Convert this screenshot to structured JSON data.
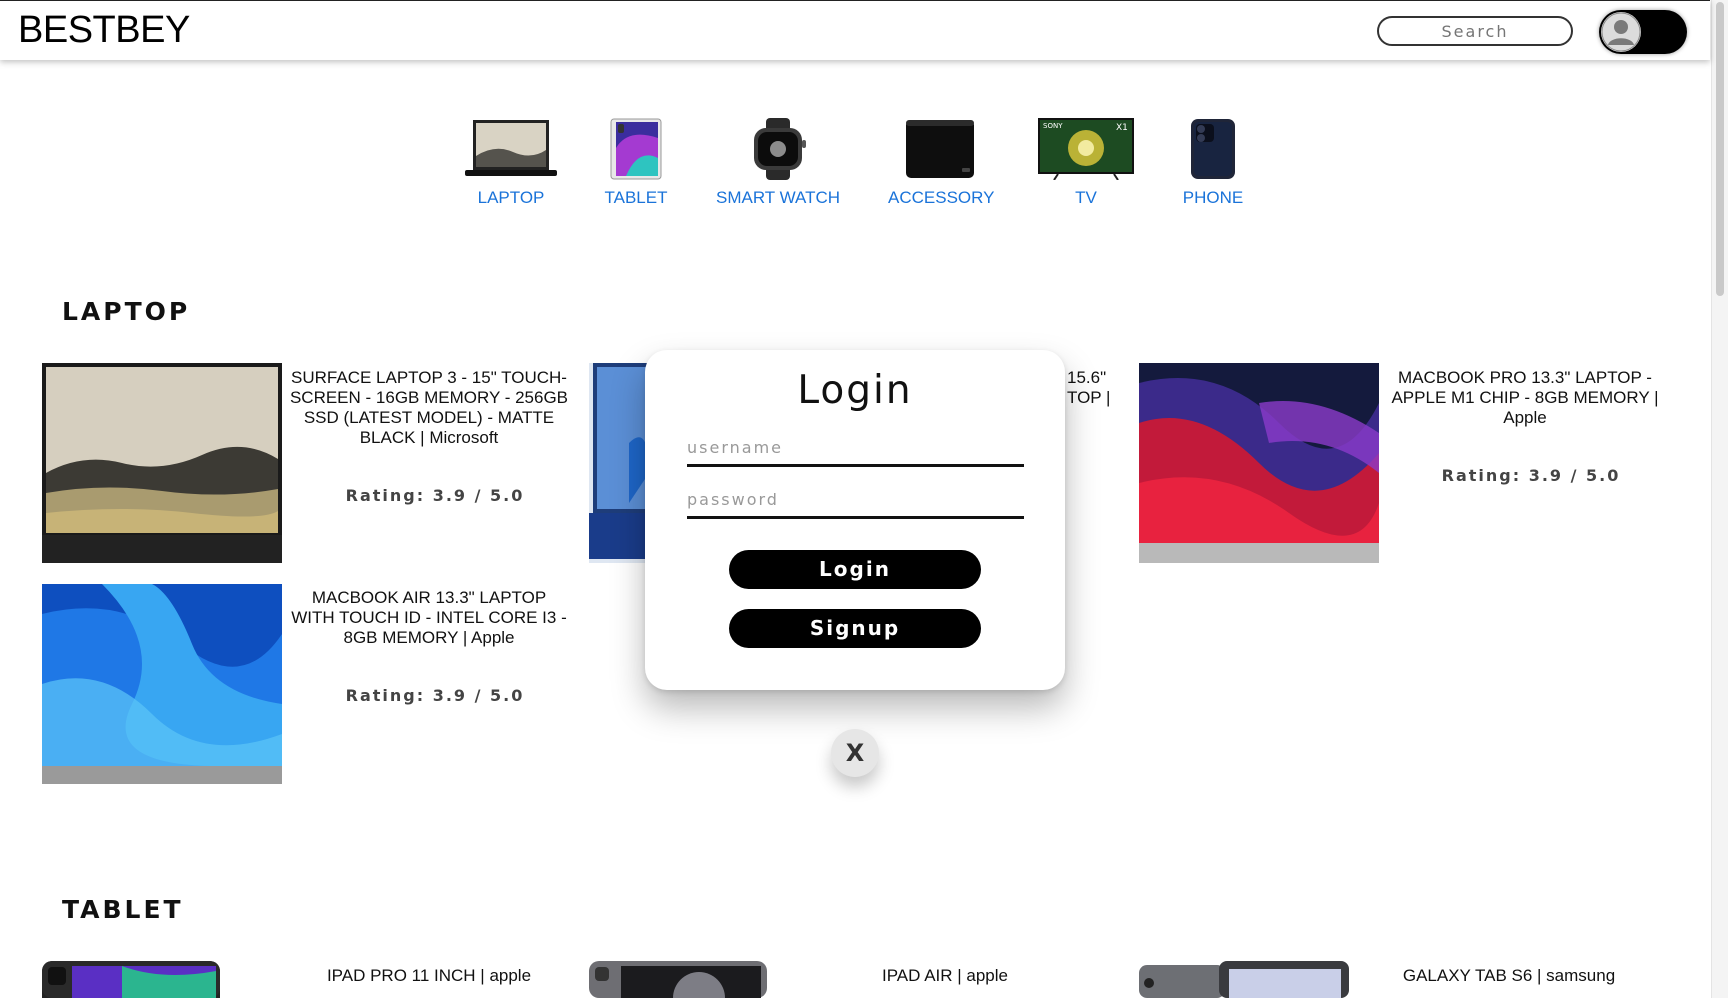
{
  "header": {
    "brand": "BESTBEY",
    "search_placeholder": "Search",
    "user_icon": "user-avatar-icon"
  },
  "categories": [
    {
      "label": "LAPTOP",
      "icon": "laptop-icon"
    },
    {
      "label": "TABLET",
      "icon": "tablet-icon"
    },
    {
      "label": "SMART WATCH",
      "icon": "smartwatch-icon"
    },
    {
      "label": "ACCESSORY",
      "icon": "hard-drive-icon"
    },
    {
      "label": "TV",
      "icon": "tv-icon"
    },
    {
      "label": "PHONE",
      "icon": "phone-icon"
    }
  ],
  "sections": {
    "laptop": {
      "title": "LAPTOP",
      "products": [
        {
          "name": "SURFACE LAPTOP 3 - 15\" TOUCH-SCREEN - 16GB MEMORY - 256GB SSD (LATEST MODEL) - MATTE BLACK | Microsoft",
          "rating": "Rating: 3.9 / 5.0"
        },
        {
          "name_fragment_1": "15.6\"",
          "name_fragment_2": "TOP |"
        },
        {
          "name": "MACBOOK PRO 13.3\" LAPTOP - APPLE M1 CHIP - 8GB MEMORY | Apple",
          "rating": "Rating: 3.9 / 5.0"
        },
        {
          "name": "MACBOOK AIR 13.3\" LAPTOP WITH TOUCH ID - INTEL CORE I3 - 8GB MEMORY | Apple",
          "rating": "Rating: 3.9 / 5.0"
        }
      ]
    },
    "tablet": {
      "title": "TABLET",
      "products": [
        {
          "name": "IPAD PRO 11 INCH | apple"
        },
        {
          "name": "IPAD AIR | apple"
        },
        {
          "name": "GALAXY TAB S6 | samsung"
        }
      ]
    }
  },
  "login_modal": {
    "title": "Login",
    "username_placeholder": "username",
    "password_placeholder": "password",
    "login_label": "Login",
    "signup_label": "Signup",
    "close_label": "X"
  },
  "colors": {
    "category_link": "#1a73d9",
    "button_bg": "#000000"
  }
}
